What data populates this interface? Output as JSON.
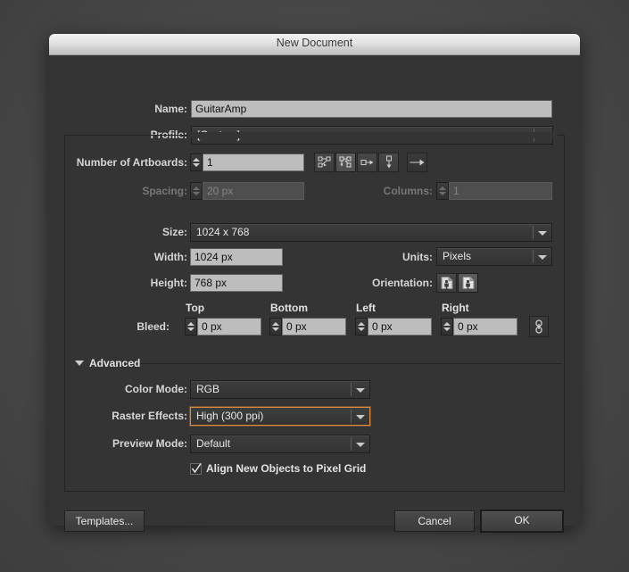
{
  "window": {
    "title": "New Document"
  },
  "fields": {
    "name_label": "Name:",
    "name_value": "GuitarAmp",
    "profile_label": "Profile:",
    "profile_value": "[Custom]",
    "artboards_label": "Number of Artboards:",
    "artboards_value": "1",
    "spacing_label": "Spacing:",
    "spacing_value": "20 px",
    "columns_label": "Columns:",
    "columns_value": "1",
    "size_label": "Size:",
    "size_value": "1024 x 768",
    "width_label": "Width:",
    "width_value": "1024 px",
    "height_label": "Height:",
    "height_value": "768 px",
    "units_label": "Units:",
    "units_value": "Pixels",
    "orientation_label": "Orientation:"
  },
  "artboard_layout": {
    "grid_by_row_icon": "grid-by-row-icon",
    "grid_by_column_icon": "grid-by-column-icon",
    "arrange_by_row_icon": "arrange-by-row-icon",
    "arrange_by_column_icon": "arrange-by-column-icon",
    "change_to_rtl_icon": "change-to-right-to-left-layout-icon"
  },
  "orientation": {
    "portrait_icon": "portrait-orientation-icon",
    "landscape_icon": "landscape-orientation-icon"
  },
  "bleed": {
    "label": "Bleed:",
    "top_header": "Top",
    "bottom_header": "Bottom",
    "left_header": "Left",
    "right_header": "Right",
    "top_value": "0 px",
    "bottom_value": "0 px",
    "left_value": "0 px",
    "right_value": "0 px",
    "link_icon": "chain-link-icon"
  },
  "advanced": {
    "title": "Advanced",
    "color_mode_label": "Color Mode:",
    "color_mode_value": "RGB",
    "raster_effects_label": "Raster Effects:",
    "raster_effects_value": "High (300 ppi)",
    "preview_mode_label": "Preview Mode:",
    "preview_mode_value": "Default",
    "align_pixel_grid_label": "Align New Objects to Pixel Grid",
    "align_pixel_grid_checked": true
  },
  "buttons": {
    "templates": "Templates...",
    "cancel": "Cancel",
    "ok": "OK"
  },
  "colors": {
    "dialog_bg": "#343434",
    "desktop_bg": "#4a4a4a",
    "field_bg": "#bdbdbd",
    "focus_ring": "#e08a3c",
    "text": "#d6d6d6"
  }
}
